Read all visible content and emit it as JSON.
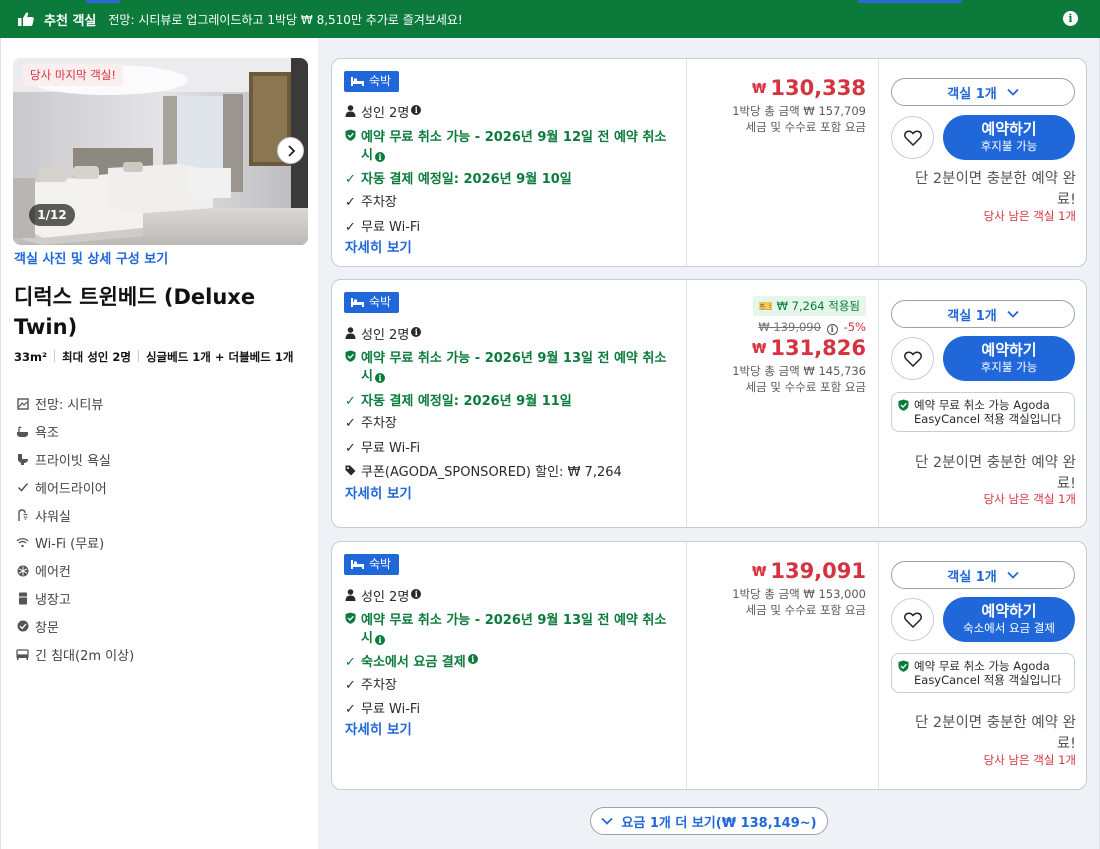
{
  "banner": {
    "title": "추천 객실",
    "message": "전망: 시티뷰로 업그레이드하고 1박당 ₩ 8,510만 추가로 즐겨보세요!",
    "info_icon": "info-icon",
    "background": "#0b7a3b"
  },
  "room": {
    "last_room_badge": "당사 마지막 객실!",
    "photo_counter": "1/12",
    "photo_link": "객실 사진 및 상세 구성 보기",
    "title": "디럭스 트윈베드 (Deluxe Twin)",
    "size": "33m²",
    "max_guests": "최대 성인 2명",
    "beds": "싱글베드 1개 + 더블베드 1개",
    "amenities": [
      {
        "icon": "window-view-icon",
        "label": "전망: 시티뷰"
      },
      {
        "icon": "bathtub-icon",
        "label": "욕조"
      },
      {
        "icon": "toilet-icon",
        "label": "프라이빗 욕실"
      },
      {
        "icon": "check-icon",
        "label": "헤어드라이어"
      },
      {
        "icon": "shower-icon",
        "label": "샤워실"
      },
      {
        "icon": "wifi-icon",
        "label": "Wi-Fi (무료)"
      },
      {
        "icon": "snowflake-icon",
        "label": "에어컨"
      },
      {
        "icon": "fridge-icon",
        "label": "냉장고"
      },
      {
        "icon": "check-circle-icon",
        "label": "창문"
      },
      {
        "icon": "bed-icon",
        "label": "긴 침대(2m 이상)"
      }
    ]
  },
  "offers": [
    {
      "stay_label": "숙박",
      "guests": "성인 2명",
      "cancel": "예약 무료 취소 가능 - 2026년 9월 12일 전 예약 취소 시",
      "payment": "자동 결제 예정일: 2026년 9월 10일",
      "parking": "주차장",
      "wifi": "무료 Wi-Fi",
      "details": "자세히 보기",
      "currency": "₩",
      "price": "130,338",
      "per_night_total": "1박당 총 금액 ₩ 157,709",
      "tax_note": "세금 및 수수료 포함 요금",
      "room_select": "객실 1개",
      "book_label": "예약하기",
      "book_sub": "후지불 가능",
      "hurry": "단 2분이면 충분한 예약 완료!",
      "rooms_left": "당사 남은 객실 1개"
    },
    {
      "stay_label": "숙박",
      "guests": "성인 2명",
      "cancel": "예약 무료 취소 가능 - 2026년 9월 13일 전 예약 취소 시",
      "payment": "자동 결제 예정일: 2026년 9월 11일",
      "parking": "주차장",
      "wifi": "무료 Wi-Fi",
      "coupon": "쿠폰(AGODA_SPONSORED) 할인: ₩ 7,264",
      "details": "자세히 보기",
      "applied": "₩ 7,264 적용됨",
      "original_price": "₩ 139,090",
      "discount": "-5%",
      "currency": "₩",
      "price": "131,826",
      "per_night_total": "1박당 총 금액 ₩ 145,736",
      "tax_note": "세금 및 수수료 포함 요금",
      "room_select": "객실 1개",
      "book_label": "예약하기",
      "book_sub": "후지불 가능",
      "easycancel": "예약 무료 취소 가능 Agoda EasyCancel 적용 객실입니다",
      "hurry": "단 2분이면 충분한 예약 완료!",
      "rooms_left": "당사 남은 객실 1개"
    },
    {
      "stay_label": "숙박",
      "guests": "성인 2명",
      "cancel": "예약 무료 취소 가능 - 2026년 9월 13일 전 예약 취소 시",
      "payment": "숙소에서 요금 결제",
      "parking": "주차장",
      "wifi": "무료 Wi-Fi",
      "details": "자세히 보기",
      "currency": "₩",
      "price": "139,091",
      "per_night_total": "1박당 총 금액 ₩ 153,000",
      "tax_note": "세금 및 수수료 포함 요금",
      "room_select": "객실 1개",
      "book_label": "예약하기",
      "book_sub": "숙소에서 요금 결제",
      "easycancel": "예약 무료 취소 가능 Agoda EasyCancel 적용 객실입니다",
      "hurry": "단 2분이면 충분한 예약 완료!",
      "rooms_left": "당사 남은 객실 1개"
    }
  ],
  "more_rates": "요금 1개 더 보기(₩ 138,149~)",
  "colors": {
    "accent": "#2067da",
    "price_red": "#d5333f",
    "green": "#0b7a3b"
  }
}
